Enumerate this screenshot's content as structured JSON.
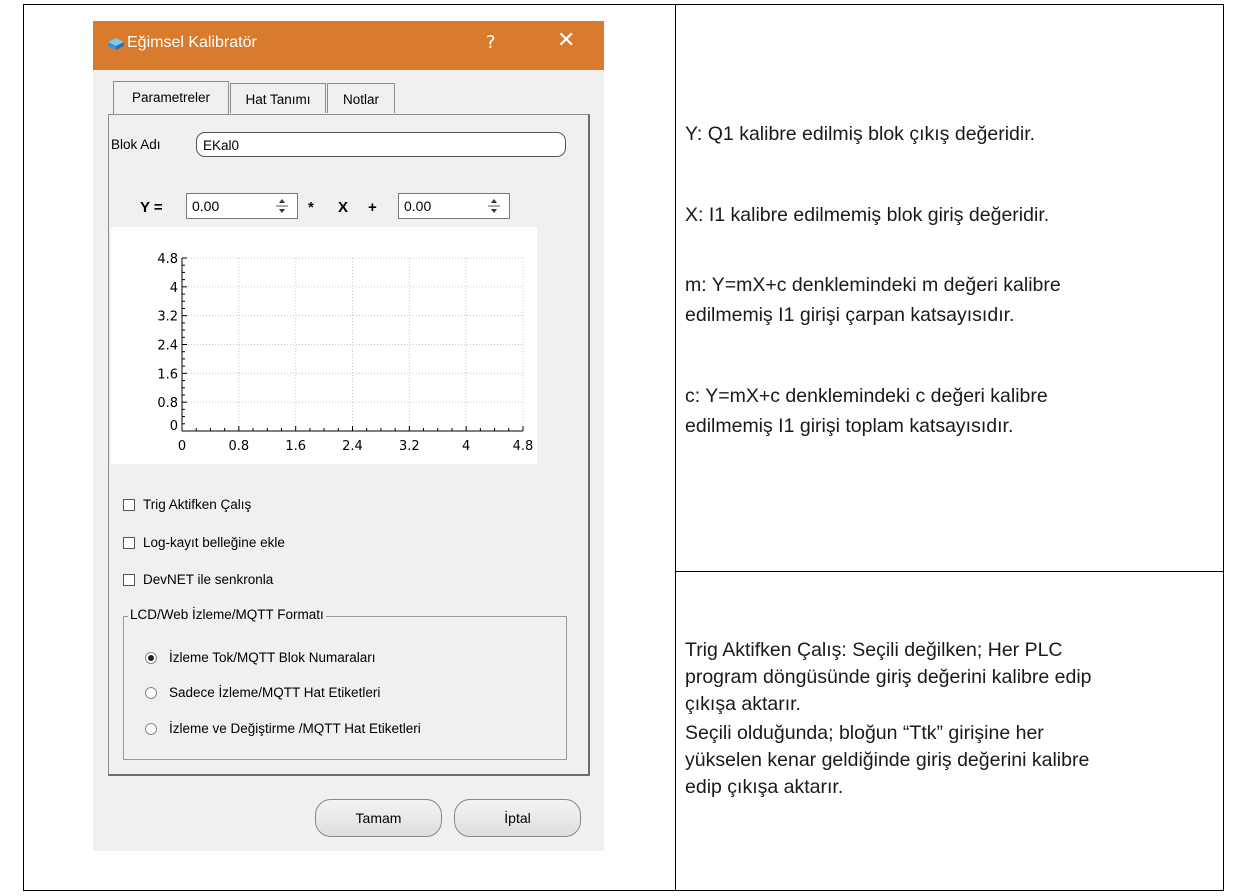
{
  "dialog": {
    "title": "Eğimsel Kalibratör",
    "help_label": "?",
    "close_label": "✕",
    "tabs": [
      {
        "label": "Parametreler",
        "active": true
      },
      {
        "label": "Hat Tanımı",
        "active": false
      },
      {
        "label": "Notlar",
        "active": false
      }
    ],
    "block_name_label": "Blok Adı",
    "block_name_value": "EKal0",
    "equation": {
      "y_label": "Y =",
      "m_value": "0.00",
      "mult_sign": "*",
      "x_label": "X",
      "plus_sign": "+",
      "c_value": "0.00"
    },
    "checkboxes": [
      {
        "label": "Trig Aktifken Çalış",
        "checked": false
      },
      {
        "label": "Log-kayıt belleğine ekle",
        "checked": false
      },
      {
        "label": "DevNET ile senkronla",
        "checked": false
      }
    ],
    "format_group": {
      "title": "LCD/Web İzleme/MQTT Formatı",
      "options": [
        {
          "label": "İzleme Tok/MQTT Blok Numaraları",
          "selected": true
        },
        {
          "label": "Sadece İzleme/MQTT Hat Etiketleri",
          "selected": false
        },
        {
          "label": "İzleme ve Değiştirme /MQTT Hat Etiketleri",
          "selected": false
        }
      ]
    },
    "ok_label": "Tamam",
    "cancel_label": "İptal"
  },
  "chart_data": {
    "type": "line",
    "title": "",
    "xlabel": "",
    "ylabel": "",
    "xlim": [
      0,
      4.8
    ],
    "ylim": [
      0,
      4.8
    ],
    "x_ticks": [
      "0",
      "0.8",
      "1.6",
      "2.4",
      "3.2",
      "4",
      "4.8"
    ],
    "y_ticks": [
      "0",
      "0.8",
      "1.6",
      "2.4",
      "3.2",
      "4",
      "4.8"
    ],
    "grid": true,
    "series": []
  },
  "notes": {
    "y_desc": "Y:  Q1 kalibre edilmiş blok çıkış değeridir.",
    "x_desc": "X:  I1 kalibre edilmemiş blok giriş değeridir.",
    "m_desc_line1": "m:  Y=mX+c denklemindeki m değeri kalibre",
    "m_desc_line2": "edilmemiş I1 girişi çarpan katsayısıdır.",
    "c_desc_line1": "c:  Y=mX+c denklemindeki c değeri kalibre",
    "c_desc_line2": "edilmemiş I1 girişi toplam katsayısıdır.",
    "trig_line1": "Trig Aktifken Çalış:  Seçili değilken; Her PLC",
    "trig_line2": "program döngüsünde giriş değerini kalibre edip",
    "trig_line3": "çıkışa aktarır.",
    "trig_line4": "Seçili olduğunda; bloğun “Ttk” girişine her",
    "trig_line5": "yükselen kenar geldiğinde giriş değerini kalibre",
    "trig_line6": "edip çıkışa aktarır."
  }
}
